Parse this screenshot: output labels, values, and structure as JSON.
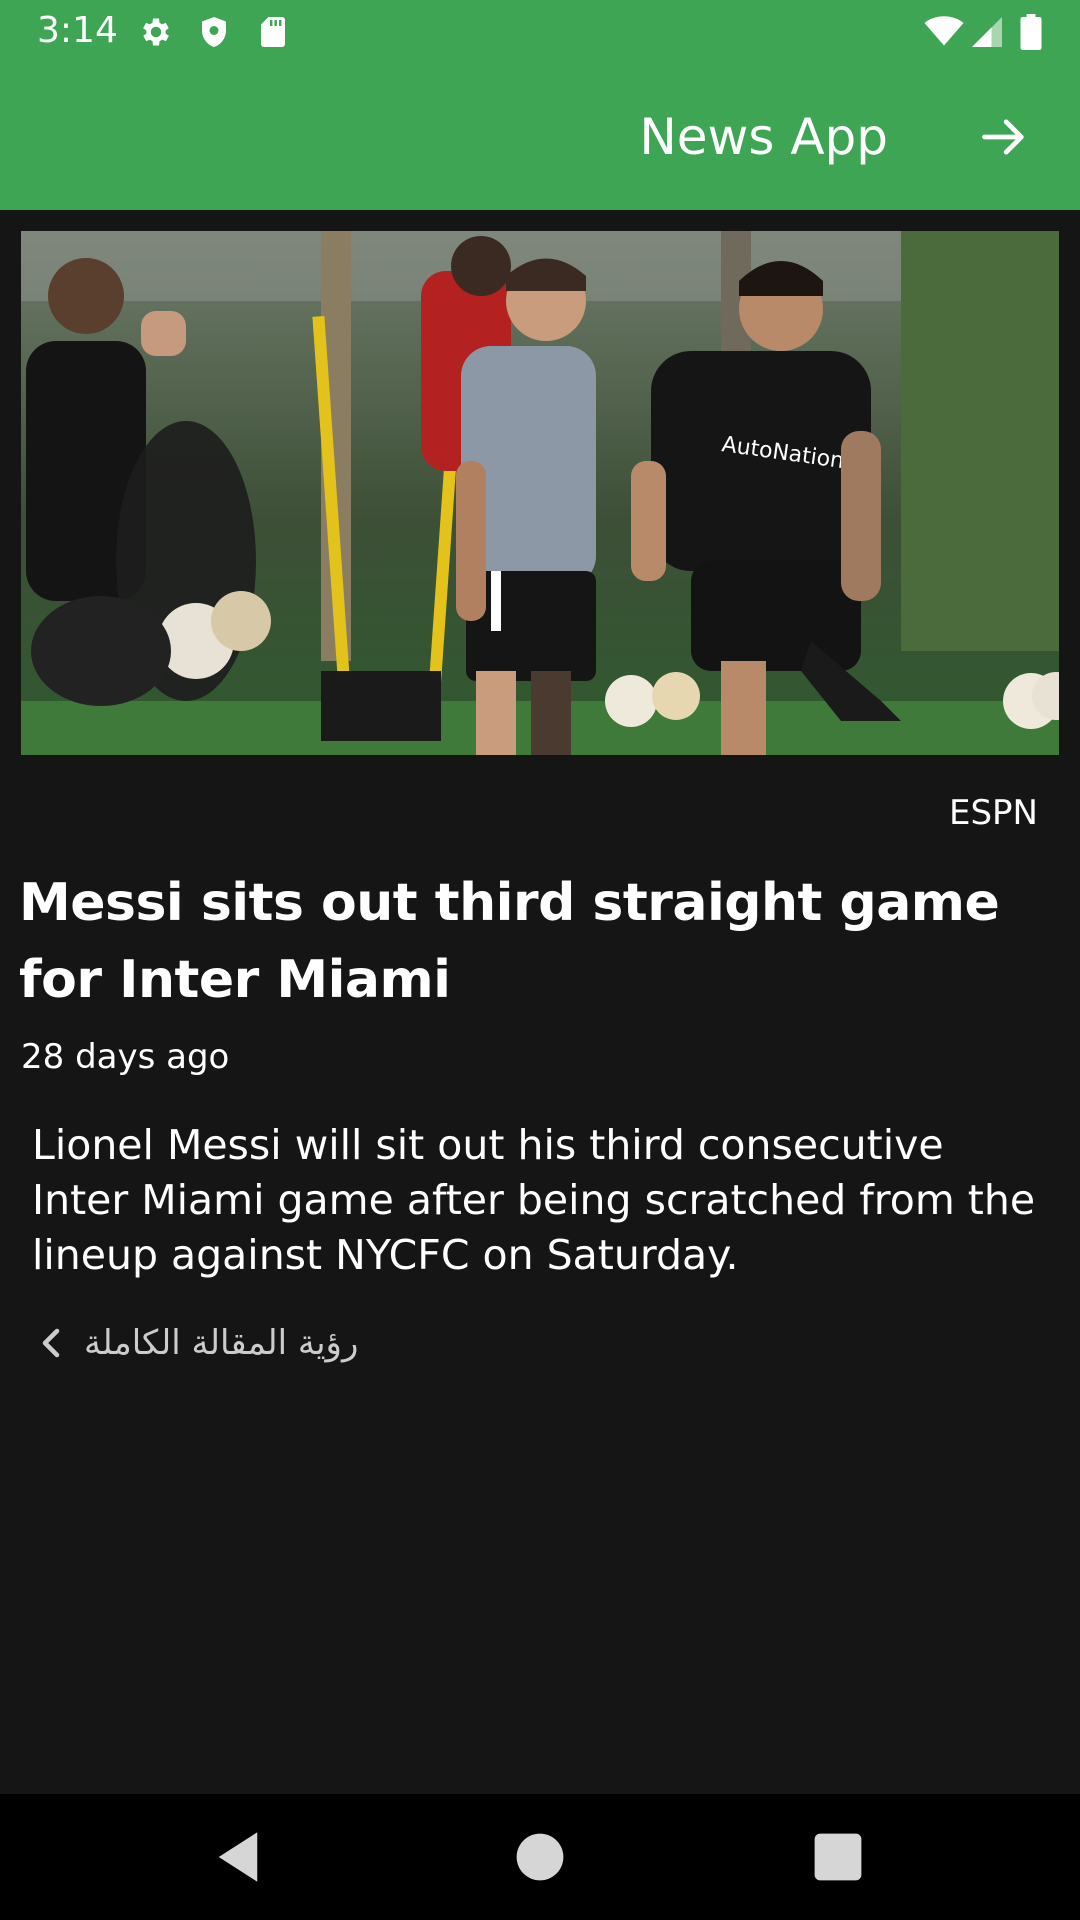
{
  "status_bar": {
    "time": "3:14",
    "left_icons": [
      "settings-icon",
      "shield-icon",
      "sd-card-icon"
    ],
    "right_icons": [
      "wifi-icon",
      "signal-icon",
      "battery-icon"
    ]
  },
  "app_bar": {
    "title": "News App",
    "forward_icon": "arrow-forward-icon",
    "color": "#3da553"
  },
  "article": {
    "image_description": "Inter Miami training session",
    "source": "ESPN",
    "title": "Messi sits out third straight game for Inter Miami",
    "published": "28 days ago",
    "description": "Lionel Messi will sit out his third consecutive Inter Miami game after being scratched from the lineup against NYCFC on Saturday.",
    "read_more_label": "رؤية المقالة الكاملة",
    "read_more_icon": "chevron-left-icon"
  },
  "nav_bar": {
    "back_icon": "back-triangle-icon",
    "home_icon": "home-circle-icon",
    "recents_icon": "recents-square-icon"
  }
}
